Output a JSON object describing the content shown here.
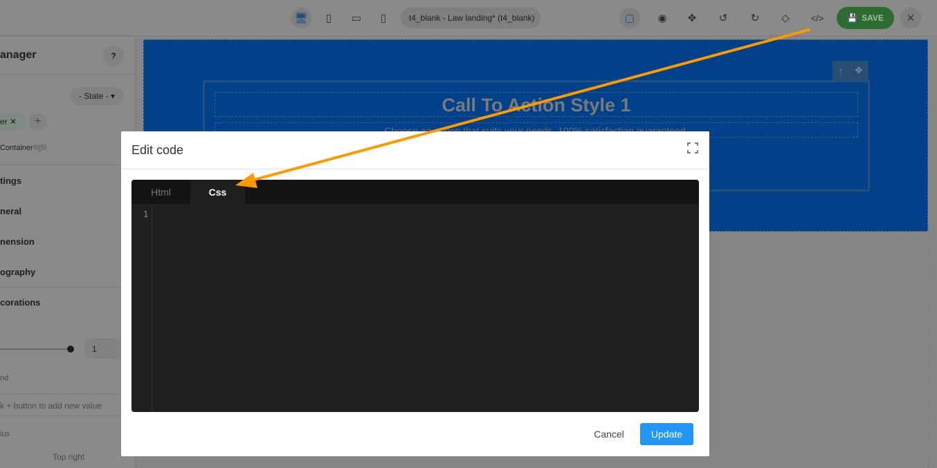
{
  "toolbar": {
    "project_title": "t4_blank - Law landing* (t4_blank)",
    "save_label": "SAVE",
    "icons": [
      "desktop-icon",
      "tablet-icon",
      "tablet-landscape-icon",
      "mobile-icon",
      "outline-icon",
      "eye-icon",
      "move-icon",
      "undo-icon",
      "redo-icon",
      "eraser-icon",
      "code-icon",
      "close-icon"
    ]
  },
  "sidebar": {
    "title": "anager",
    "help": "?",
    "state": "- State -",
    "tag": "er",
    "selected_prefix": "Container",
    "selected_id": "#ij5l",
    "sections": [
      "tings",
      "neral",
      "nension",
      "ography",
      "corations"
    ],
    "opacity_value": "1",
    "background_label": "nd",
    "hint": "k + button to add new value",
    "radius_label": "ius",
    "corner_label": "Top right"
  },
  "canvas": {
    "heading": "Call To Action Style 1",
    "subheading": "Choose an option that suits your needs. 100% satisfaction guaranteed."
  },
  "modal": {
    "title": "Edit code",
    "tabs": [
      "Html",
      "Css"
    ],
    "active_tab": "Css",
    "line_numbers": [
      "1"
    ],
    "cancel": "Cancel",
    "update": "Update"
  },
  "colors": {
    "save": "#2d6b30",
    "update": "#2196f3",
    "annotation_arrow": "#ff9900",
    "canvas": "#00418a"
  }
}
